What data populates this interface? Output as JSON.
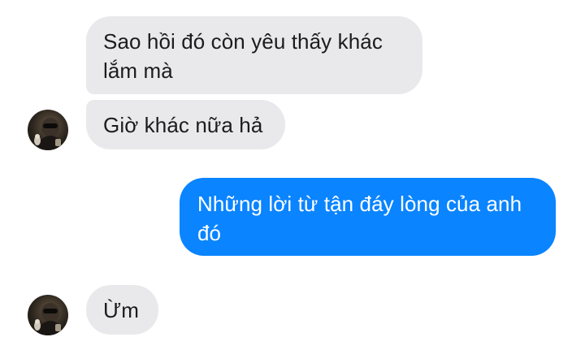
{
  "conversation": {
    "messages": [
      {
        "direction": "incoming",
        "text": "Sao hồi đó còn yêu thấy khác\nlắm mà"
      },
      {
        "direction": "incoming",
        "text": "Giờ khác nữa hả"
      },
      {
        "direction": "outgoing",
        "text": "Những lời từ tận đáy lòng của anh\nđó"
      },
      {
        "direction": "incoming",
        "text": "Ừm"
      }
    ]
  },
  "colors": {
    "incoming_bubble": "#e9e9eb",
    "outgoing_bubble": "#0a84ff",
    "incoming_text": "#1c1c1e",
    "outgoing_text": "#ffffff"
  },
  "icons": {
    "avatar": "contact-avatar-photo"
  }
}
